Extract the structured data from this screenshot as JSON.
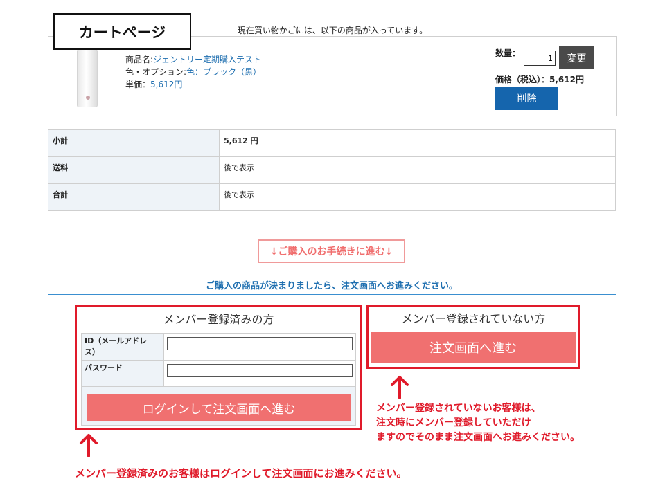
{
  "page": {
    "title": "カートページ",
    "cart_notice": "現在買い物かごには、以下の商品が入っています。"
  },
  "product": {
    "name_label": "商品名:",
    "name_value": "ジェントリー定期購入テスト",
    "option_label": "色・オプション:",
    "option_value": "色：ブラック（黒）",
    "unit_price_label": "単価：",
    "unit_price_value": "5,612円",
    "quantity_label": "数量：",
    "quantity_value": "1",
    "change_button": "変更",
    "price_label": "価格（税込）：",
    "price_value": "5,612円",
    "delete_button": "削除"
  },
  "summary": {
    "rows": [
      {
        "label": "小計",
        "value": "5,612 円"
      },
      {
        "label": "送料",
        "value": "後で表示"
      },
      {
        "label": "合計",
        "value": "後で表示"
      }
    ]
  },
  "proceed": {
    "label": "↓ご購入のお手続きに進む↓",
    "message": "ご購入の商品が決まりましたら、注文画面へお進みください。"
  },
  "member": {
    "title": "メンバー登録済みの方",
    "id_label": "ID（メールアドレス）",
    "id_label_line1": "ID（メールアドレ",
    "id_label_line2": "ス）",
    "id_value": "",
    "password_label": "パスワード",
    "password_value": "",
    "login_button": "ログインして注文画面へ進む"
  },
  "nonmember": {
    "title": "メンバー登録されていない方",
    "order_button": "注文画面へ進む"
  },
  "annotations": {
    "nonmember_note_lines": [
      "メンバー登録されていないお客様は、",
      "注文時にメンバー登録していただけ",
      "ますのでそのまま注文画面へお進みください。"
    ],
    "member_note": "メンバー登録済みのお客様はログインして注文画面にお進みください。",
    "color_accent_red": "#e01a2a",
    "color_button_pink": "#f07070",
    "color_link_blue": "#1f6fb0",
    "icons": [
      "up-arrow-icon"
    ]
  }
}
